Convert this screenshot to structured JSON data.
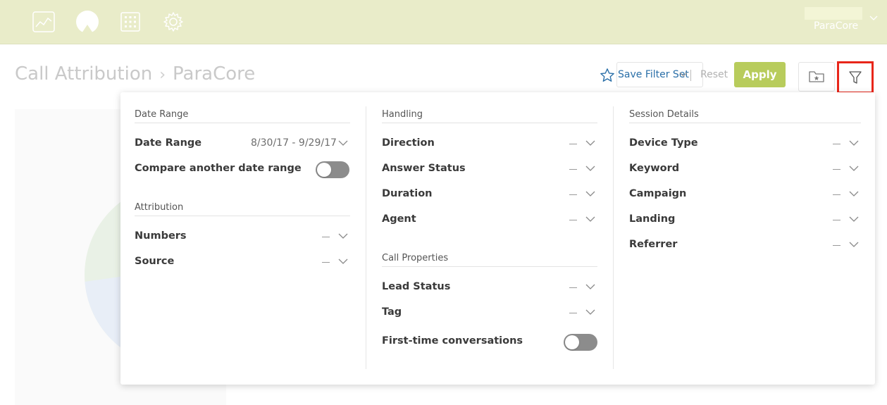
{
  "header": {
    "nav_icons": [
      "chart-icon",
      "logo-icon",
      "apps-icon",
      "gear-icon"
    ],
    "account_name": "ParaCore"
  },
  "page": {
    "title": "Call Attribution",
    "breadcrumb_sep": "›",
    "subtitle": "ParaCore"
  },
  "toolbar": {
    "save_label": "Save Filter Set",
    "reset_label": "Reset",
    "apply_label": "Apply",
    "accent_color": "#b8cc5c",
    "highlight_color": "#e8261a"
  },
  "filters": {
    "col1": {
      "date_section": "Date Range",
      "date_label": "Date Range",
      "date_value": "8/30/17 - 9/29/17",
      "compare_label": "Compare another date range",
      "compare_on": false,
      "attribution_section": "Attribution",
      "numbers_label": "Numbers",
      "source_label": "Source"
    },
    "col2": {
      "handling_section": "Handling",
      "direction_label": "Direction",
      "answer_status_label": "Answer Status",
      "duration_label": "Duration",
      "agent_label": "Agent",
      "properties_section": "Call Properties",
      "lead_status_label": "Lead Status",
      "tag_label": "Tag",
      "first_time_label": "First-time conversations",
      "first_time_on": false
    },
    "col3": {
      "session_section": "Session Details",
      "device_type_label": "Device Type",
      "keyword_label": "Keyword",
      "campaign_label": "Campaign",
      "landing_label": "Landing",
      "referrer_label": "Referrer"
    }
  }
}
